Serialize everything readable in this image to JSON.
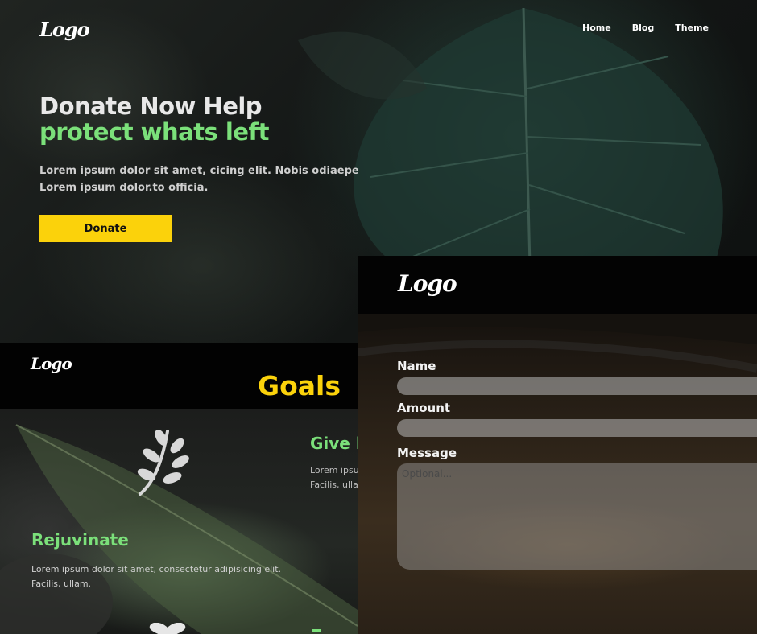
{
  "hero": {
    "logo": "Logo",
    "nav": [
      "Home",
      "Blog",
      "Theme"
    ],
    "headline_line1": "Donate Now Help",
    "headline_line2": "protect whats left",
    "lead_line1": "Lorem ipsum dolor sit amet, cicing elit. Nobis odiaepe",
    "lead_line2": "Lorem ipsum dolor.to officia.",
    "donate_label": "Donate"
  },
  "goals": {
    "logo": "Logo",
    "title": "Goals",
    "give_title": "Give l",
    "give_text_line1": "Lorem ipsu",
    "give_text_line2": "Facilis, ulla",
    "rejuvinate_title": "Rejuvinate",
    "rejuvinate_text_line1": "Lorem ipsum dolor sit amet, consectetur adipisicing elit.",
    "rejuvinate_text_line2": "Facilis, ullam."
  },
  "form": {
    "logo": "Logo",
    "name_label": "Name",
    "amount_label": "Amount",
    "message_label": "Message",
    "message_placeholder": "Optional..."
  },
  "colors": {
    "accent_yellow": "#fbd20b",
    "accent_green": "#7be07a"
  }
}
